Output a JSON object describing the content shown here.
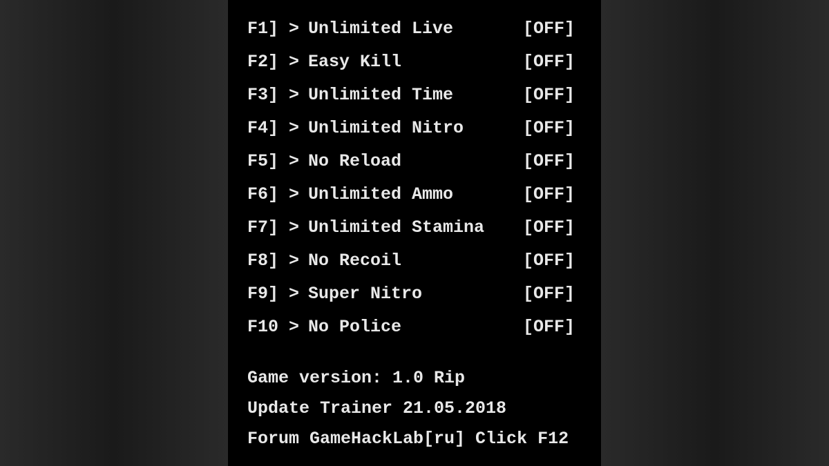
{
  "cheats": [
    {
      "key": "F1]",
      "name": "Unlimited Live",
      "status": "[OFF]"
    },
    {
      "key": "F2]",
      "name": "Easy Kill",
      "status": "[OFF]"
    },
    {
      "key": "F3]",
      "name": "Unlimited Time",
      "status": "[OFF]"
    },
    {
      "key": "F4]",
      "name": "Unlimited Nitro",
      "status": "[OFF]"
    },
    {
      "key": "F5]",
      "name": "No Reload",
      "status": "[OFF]"
    },
    {
      "key": "F6]",
      "name": "Unlimited Ammo",
      "status": "[OFF]"
    },
    {
      "key": "F7]",
      "name": "Unlimited Stamina",
      "status": "[OFF]"
    },
    {
      "key": "F8]",
      "name": "No Recoil",
      "status": "[OFF]"
    },
    {
      "key": "F9]",
      "name": "Super Nitro",
      "status": "[OFF]"
    },
    {
      "key": "F10",
      "name": "No Police",
      "status": "[OFF]"
    }
  ],
  "arrow": ">",
  "info": {
    "version": "Game version: 1.0 Rip",
    "update": "Update Trainer 21.05.2018",
    "forum": "Forum GameHackLab[ru] Click F12"
  }
}
